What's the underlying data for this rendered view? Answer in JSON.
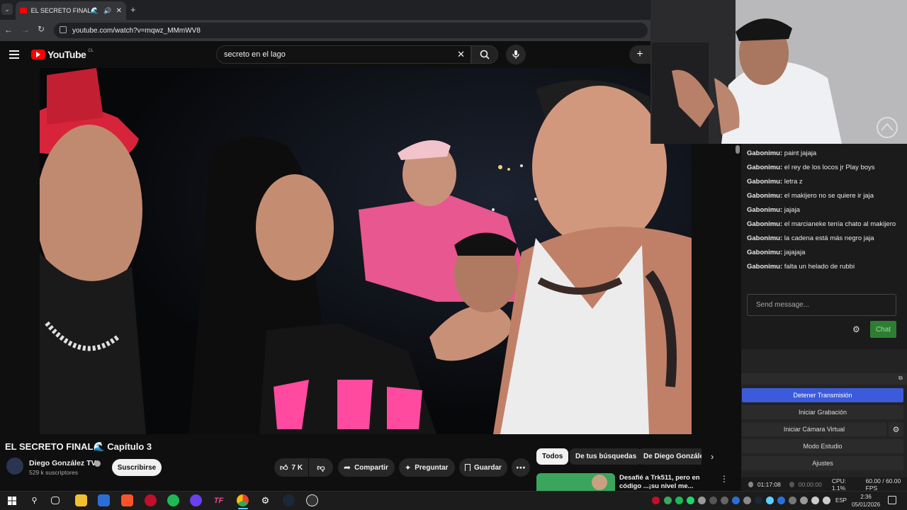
{
  "browser": {
    "tab_title": "EL SECRETO FINAL🌊 Capítulo 3",
    "url": "youtube.com/watch?v=mqwz_MMmWV8"
  },
  "youtube": {
    "logo_text": "YouTube",
    "region": "CL",
    "search_value": "secreto en el lago",
    "video_title": "EL SECRETO FINAL🌊 Capítulo 3",
    "channel_name": "Diego González TV",
    "subscribers": "529 k suscriptores",
    "subscribe_label": "Suscribirse",
    "likes": "7 K",
    "share_label": "Compartir",
    "ask_label": "Preguntar",
    "save_label": "Guardar",
    "chips": [
      "Todos",
      "De tus búsquedas",
      "De Diego Gonzále"
    ],
    "rec_title_line1": "Desafié a Trk511, pero en",
    "rec_title_line2": "código ...¡su nivel me..."
  },
  "chat": {
    "messages": [
      {
        "user": "Gabonimu:",
        "text": "paint jajaja"
      },
      {
        "user": "Gabonimu:",
        "text": "el rey de los locos jr Play boys"
      },
      {
        "user": "Gabonimu:",
        "text": "letra z"
      },
      {
        "user": "Gabonimu:",
        "text": "el makijero no se quiere ir jaja"
      },
      {
        "user": "Gabonimu:",
        "text": "jajaja"
      },
      {
        "user": "Gabonimu:",
        "text": "el marcianeke tenía chato al makijero"
      },
      {
        "user": "Gabonimu:",
        "text": "la cadena está más negro jaja"
      },
      {
        "user": "Gabonimu:",
        "text": "jajajaja"
      },
      {
        "user": "Gabonimu:",
        "text": "falta un helado de rubbi"
      }
    ],
    "input_placeholder": "Send message...",
    "chat_button": "Chat"
  },
  "obs": {
    "stop_stream": "Detener Transmisión",
    "start_recording": "Iniciar Grabación",
    "start_virtual_cam": "Iniciar Cámara Virtual",
    "studio_mode": "Modo Estudio",
    "settings": "Ajustes",
    "stream_time": "01:17:08",
    "rec_time": "00:00:00",
    "cpu": "CPU: 1.1%",
    "fps": "60.00 / 60.00 FPS"
  },
  "taskbar": {
    "lang": "ESP",
    "time": "2:36",
    "date": "05/01/2026"
  },
  "colors": {
    "yt_red": "#ff0000",
    "obs_blue": "#3b5bdb",
    "chat_green": "#2e7d32"
  }
}
